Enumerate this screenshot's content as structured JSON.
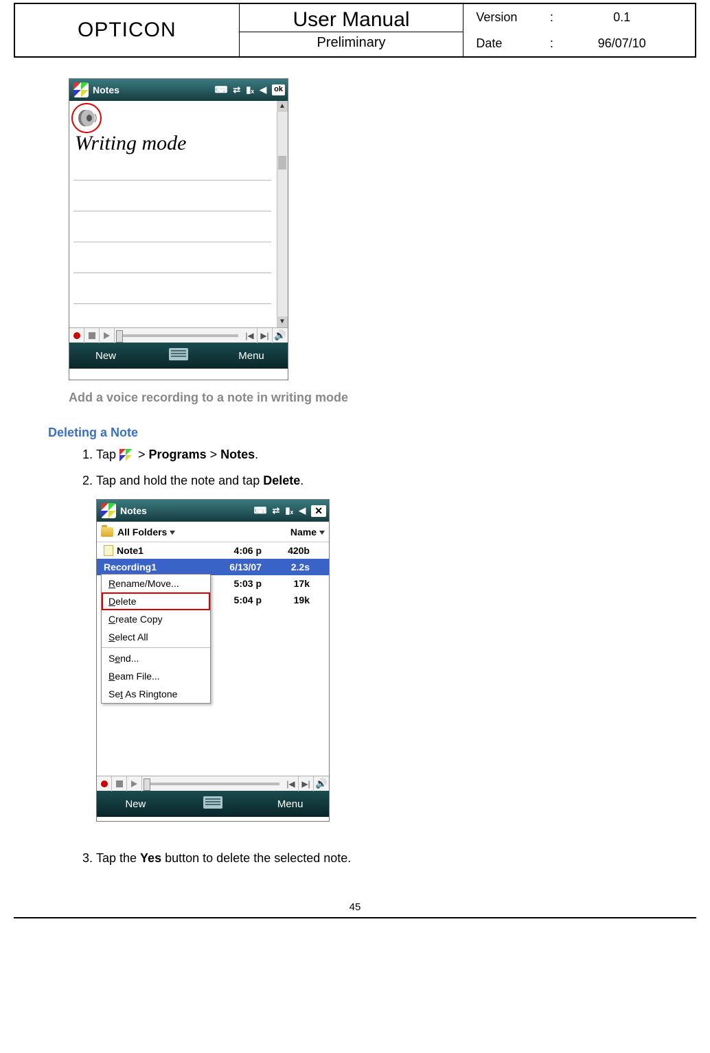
{
  "header": {
    "brand": "OPTICON",
    "title": "User Manual",
    "subtitle": "Preliminary",
    "versionLabel": "Version",
    "version": "0.1",
    "dateLabel": "Date",
    "date": "96/07/10"
  },
  "screenshot1": {
    "title": "Notes",
    "okLabel": "ok",
    "canvasText": "Writing mode",
    "bottomNew": "New",
    "bottomMenu": "Menu"
  },
  "caption1": "Add a voice recording to a note in writing mode",
  "section": {
    "heading": "Deleting a Note",
    "step1_pre": "Tap ",
    "step1_mid": " > ",
    "step1_b1": "Programs",
    "step1_b2": "Notes",
    "step1_end": ".",
    "step2_pre": "Tap and hold the note and tap ",
    "step2_b": "Delete",
    "step2_end": ".",
    "step3_pre": "Tap the ",
    "step3_b": "Yes",
    "step3_end": " button to delete the selected note."
  },
  "screenshot2": {
    "title": "Notes",
    "folderLabel": "All Folders",
    "sortLabel": "Name",
    "files": [
      {
        "name": "Note1",
        "col2": "4:06 p",
        "col3": "420b",
        "sel": false
      },
      {
        "name": "Recording1",
        "col2": "6/13/07",
        "col3": "2.2s",
        "sel": true
      },
      {
        "name": "",
        "col2": "5:03 p",
        "col3": "17k",
        "sel": false
      },
      {
        "name": "",
        "col2": "5:04 p",
        "col3": "19k",
        "sel": false
      }
    ],
    "menu": {
      "rename": "Rename/Move...",
      "delete": "Delete",
      "createCopy": "Create Copy",
      "selectAll": "Select All",
      "send": "Send...",
      "beam": "Beam File...",
      "ringtone": "Set As Ringtone"
    },
    "bottomNew": "New",
    "bottomMenu": "Menu"
  },
  "pageNumber": "45"
}
